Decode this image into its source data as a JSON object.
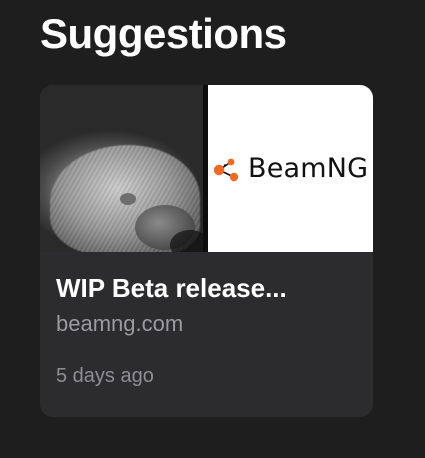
{
  "section": {
    "title": "Suggestions"
  },
  "card": {
    "title": "WIP Beta release...",
    "domain": "beamng.com",
    "time": "5 days ago",
    "thumbnail": {
      "photo_icon": "hedgehog-photo",
      "logo_text": "BeamNG",
      "logo_icon": "beamng-logo-icon",
      "logo_color": "#f26a21"
    }
  },
  "colors": {
    "background": "#1e1e1f",
    "card": "#2c2c2e",
    "primary_text": "#ffffff",
    "secondary_text": "#9a9a9f"
  }
}
